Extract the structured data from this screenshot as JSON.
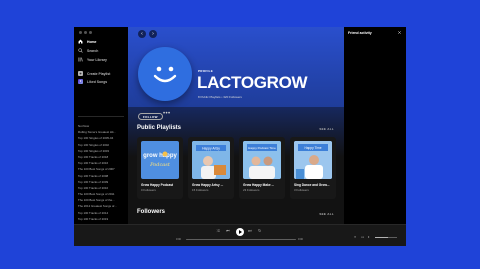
{
  "sidebar": {
    "nav": [
      {
        "label": "Home",
        "icon": "home-icon"
      },
      {
        "label": "Search",
        "icon": "search-icon"
      },
      {
        "label": "Your Library",
        "icon": "library-icon"
      }
    ],
    "actions": [
      {
        "label": "Create Playlist",
        "icon": "plus-icon"
      },
      {
        "label": "Liked Songs",
        "icon": "heart-icon"
      }
    ],
    "playlists": [
      "Not Now",
      "Rolling Stone's Greatest Hit...",
      "Top 100 Singles of 2005-04",
      "Top 100 Singles of 2002",
      "Top 100 Singles of 2003",
      "Top 100 Tracks of 2018",
      "Top 100 Tracks of 2016",
      "The 100 Best Songs of 2007",
      "Top 100 Tracks of 2008",
      "Top 100 Tracks of 2009",
      "Top 100 Tracks of 2010",
      "The 100 Best Songs of 2011",
      "The 100 Best Songs of the...",
      "The 2012 Greatest Songs of...",
      "Top 100 Tracks of 2014",
      "Top 100 Tracks of 2019",
      "NME's 50 Best Songs Of...",
      "TMS Best Songs Of NME's...",
      "NME's 50 most uplifting so..."
    ]
  },
  "profile": {
    "type_label": "PROFILE",
    "name": "LACTOGROW",
    "meta": "8 Public Playlists • 320 Followers",
    "follow_label": "FOLLOW",
    "more_label": "•••"
  },
  "sections": {
    "playlists_title": "Public Playlists",
    "followers_title": "Followers",
    "see_all": "SEE ALL"
  },
  "cards": [
    {
      "title": "Grow Happy Podcast",
      "subtitle": "0 Followers",
      "art_text": "grow happy Podcast"
    },
    {
      "title": "Grow Happy Artsy ...",
      "subtitle": "15 Followers",
      "art_text": "Happy Artsy"
    },
    {
      "title": "Grow Happy Make ...",
      "subtitle": "23 Followers",
      "art_text": "Happy Podcast Time"
    },
    {
      "title": "Sing Dance and Grow...",
      "subtitle": "3 Followers",
      "art_text": "Happy Time"
    }
  ],
  "right_panel": {
    "title": "Friend activity"
  },
  "player": {
    "elapsed": "0:00",
    "duration": "0:00",
    "volume": 0.6
  },
  "colors": {
    "background": "#1f43d8",
    "hero": "#2a4fcd",
    "avatar": "#2f6ee0",
    "card_art": "#4f8fe0"
  }
}
